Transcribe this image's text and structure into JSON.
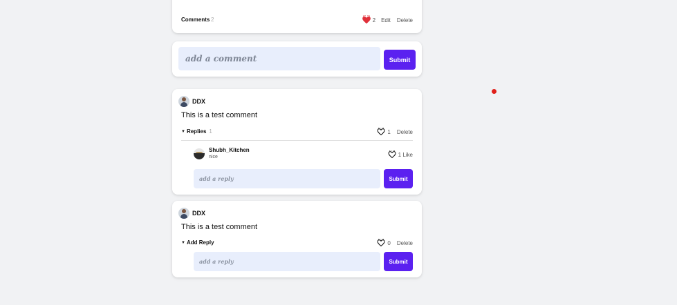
{
  "post": {
    "comments_label": "Comments",
    "comments_count": "2",
    "likes_count": "2",
    "edit_label": "Edit",
    "delete_label": "Delete",
    "liked_color": "#e0303a"
  },
  "comment_form": {
    "placeholder": "add a comment",
    "submit_label": "Submit"
  },
  "comments": [
    {
      "author": "DDX",
      "text": "This is a test comment",
      "toggle_label": "Replies",
      "replies_count": "1",
      "likes_count": "1",
      "delete_label": "Delete",
      "replies": [
        {
          "author": "Shubh_Kitchen",
          "text": "nice",
          "likes_label": "1 Like"
        }
      ],
      "reply_placeholder": "add a reply",
      "reply_submit_label": "Submit"
    },
    {
      "author": "DDX",
      "text": "This is a test comment",
      "toggle_label": "Add Reply",
      "likes_count": "0",
      "delete_label": "Delete",
      "reply_placeholder": "add a reply",
      "reply_submit_label": "Submit"
    }
  ],
  "colors": {
    "accent": "#5b21f0",
    "input_bg": "#e8eefc",
    "page_bg": "#f1f2f4",
    "cursor_dot": "#e0201a"
  },
  "icons": {
    "like_filled": "heart-filled-icon",
    "like_outline": "heart-outline-icon",
    "toggle": "caret-down-icon"
  }
}
